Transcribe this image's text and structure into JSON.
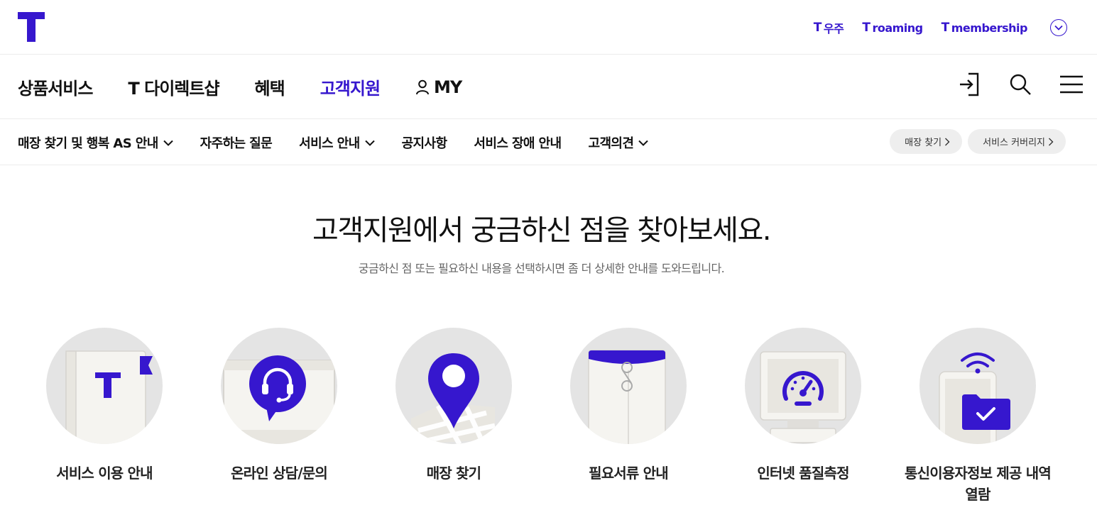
{
  "brand": {
    "accent": "#3617CE",
    "logo_letter": "T"
  },
  "top_links": [
    {
      "mark": "T",
      "label": "우주"
    },
    {
      "mark": "T",
      "label": "roaming"
    },
    {
      "mark": "T",
      "label": "membership"
    }
  ],
  "main_nav": [
    {
      "label": "상품서비스",
      "active": false
    },
    {
      "label": "T 다이렉트샵",
      "active": false
    },
    {
      "label": "혜택",
      "active": false
    },
    {
      "label": "고객지원",
      "active": true
    },
    {
      "label": "MY",
      "active": false,
      "icon": "user-icon"
    }
  ],
  "nav_actions": [
    "login-icon",
    "search-icon",
    "menu-icon"
  ],
  "sub_nav": [
    {
      "label": "매장 찾기 및 행복 AS 안내",
      "dropdown": true
    },
    {
      "label": "자주하는 질문",
      "dropdown": false
    },
    {
      "label": "서비스 안내",
      "dropdown": true
    },
    {
      "label": "공지사항",
      "dropdown": false
    },
    {
      "label": "서비스 장애 안내",
      "dropdown": false
    },
    {
      "label": "고객의견",
      "dropdown": true
    }
  ],
  "quick_pills": [
    {
      "label": "매장 찾기"
    },
    {
      "label": "서비스 커버리지"
    }
  ],
  "hero": {
    "title": "고객지원에서 궁금하신 점을 찾아보세요.",
    "subtitle": "궁금하신 점 또는 필요하신 내용을 선택하시면 좀 더 상세한 안내를 도와드립니다."
  },
  "services": [
    {
      "label": "서비스 이용 안내",
      "icon": "guide-book-icon"
    },
    {
      "label": "온라인 상담/문의",
      "icon": "headset-chat-icon"
    },
    {
      "label": "매장 찾기",
      "icon": "map-pin-icon"
    },
    {
      "label": "필요서류 안내",
      "icon": "document-envelope-icon"
    },
    {
      "label": "인터넷 품질측정",
      "icon": "speed-gauge-icon"
    },
    {
      "label": "통신이용자정보 제공 내역 열람",
      "icon": "phone-folder-check-icon"
    }
  ]
}
